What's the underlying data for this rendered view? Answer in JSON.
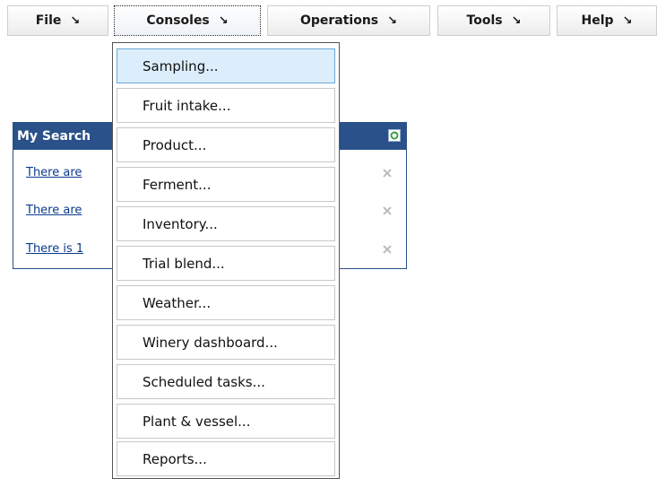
{
  "menubar": {
    "items": [
      {
        "label": "File",
        "arrow": "↘"
      },
      {
        "label": "Consoles",
        "arrow": "↘"
      },
      {
        "label": "Operations",
        "arrow": "↘"
      },
      {
        "label": "Tools",
        "arrow": "↘"
      },
      {
        "label": "Help",
        "arrow": "↘"
      }
    ]
  },
  "panel": {
    "title": "My Search",
    "refresh_icon": "refresh-icon",
    "rows": [
      {
        "text": "There are"
      },
      {
        "text": "There are"
      },
      {
        "text": "There is 1"
      }
    ],
    "close_icon": "close-icon",
    "colors": {
      "header": "#2a5189",
      "link": "#0a3a8c"
    }
  },
  "dropdown": {
    "items": [
      {
        "label": "Sampling...",
        "highlighted": true
      },
      {
        "label": "Fruit intake..."
      },
      {
        "label": "Product..."
      },
      {
        "label": "Ferment..."
      },
      {
        "label": "Inventory..."
      },
      {
        "label": "Trial blend..."
      },
      {
        "label": "Weather..."
      },
      {
        "label": "Winery dashboard..."
      },
      {
        "label": "Scheduled tasks..."
      },
      {
        "label": "Plant & vessel..."
      },
      {
        "label": "Reports..."
      }
    ],
    "colors": {
      "highlight": "#dceefb",
      "highlight_border": "#6ba7d8"
    }
  }
}
